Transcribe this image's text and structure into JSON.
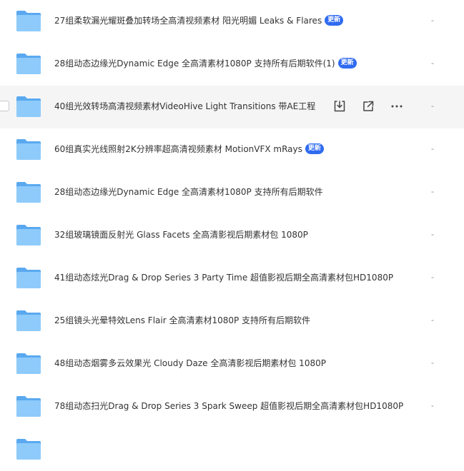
{
  "badge_label": "更新",
  "files": [
    {
      "name": "27组柔软漏光耀斑叠加转场全高清视频素材 阳光明媚 Leaks & Flares",
      "badge": true,
      "modified": "-"
    },
    {
      "name": "28组动态边缘光Dynamic Edge 全高清素材1080P 支持所有后期软件(1)",
      "badge": true,
      "modified": "-"
    },
    {
      "name": "40组光效转场高清视频素材VideoHive Light Transitions 带AE工程",
      "badge": false,
      "modified": "-",
      "hovered": true
    },
    {
      "name": "60组真实光线照射2K分辨率超高清视频素材 MotionVFX mRays",
      "badge": true,
      "modified": "-"
    },
    {
      "name": "28组动态边缘光Dynamic Edge 全高清素材1080P 支持所有后期软件",
      "badge": false,
      "modified": "-"
    },
    {
      "name": "32组玻璃镜面反射光 Glass Facets 全高清影视后期素材包 1080P",
      "badge": false,
      "modified": "-"
    },
    {
      "name": "41组动态炫光Drag & Drop Series 3 Party Time 超值影视后期全高清素材包HD1080P",
      "badge": false,
      "modified": "-"
    },
    {
      "name": "25组镜头光晕特效Lens Flair 全高清素材1080P 支持所有后期软件",
      "badge": false,
      "modified": "-"
    },
    {
      "name": "48组动态烟雾多云效果光 Cloudy Daze 全高清影视后期素材包 1080P",
      "badge": false,
      "modified": "-"
    },
    {
      "name": "78组动态扫光Drag & Drop Series 3 Spark Sweep 超值影视后期全高清素材包HD1080P",
      "badge": false,
      "modified": "-"
    }
  ],
  "icons": {
    "folder": "folder-icon",
    "download": "download-icon",
    "share": "share-icon",
    "more": "more-icon"
  },
  "colors": {
    "folder_back": "#5aa9f0",
    "folder_front": "#8ecbfb",
    "badge": "#2f6bf0",
    "hover_row": "#f5f5f6"
  }
}
